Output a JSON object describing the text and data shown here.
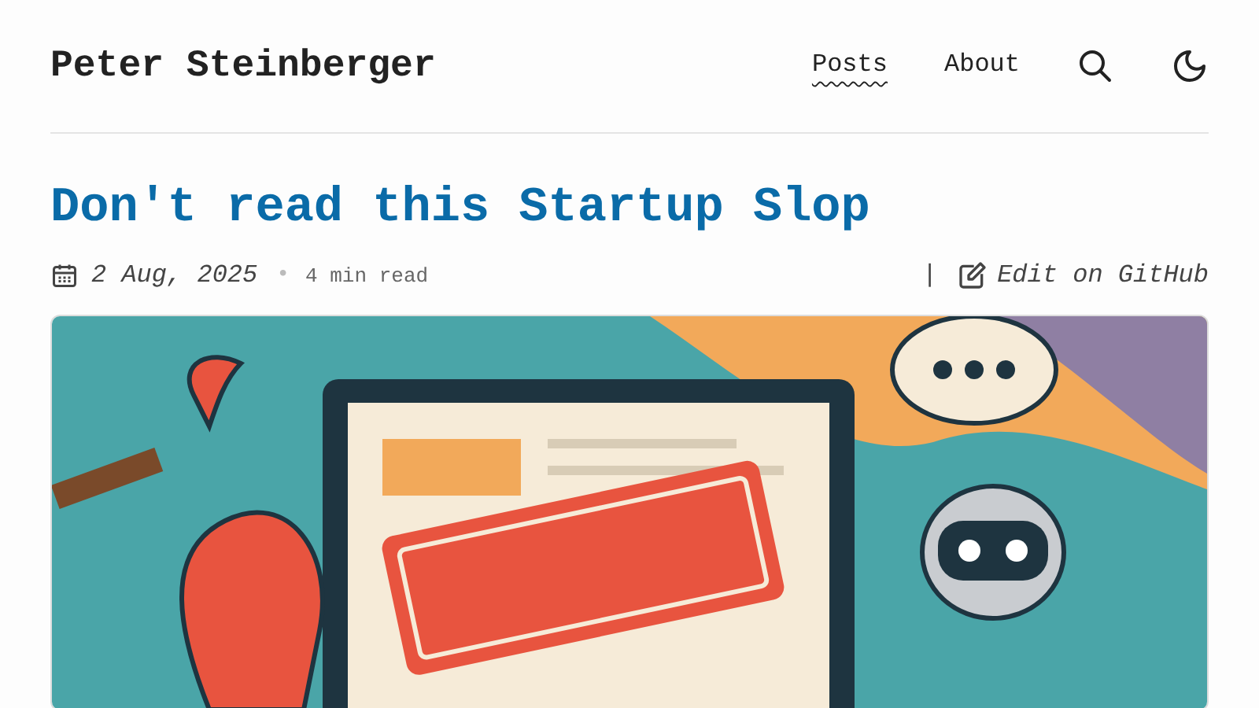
{
  "site_title": "Peter Steinberger",
  "nav": [
    {
      "label": "Posts",
      "selected": true
    },
    {
      "label": "About",
      "selected": false
    }
  ],
  "post": {
    "title": "Don't read this Startup Slop",
    "date": "2 Aug, 2025",
    "separator": "•",
    "reading_time": "4 min read",
    "divider": "|",
    "edit_link": "Edit on GitHub"
  }
}
